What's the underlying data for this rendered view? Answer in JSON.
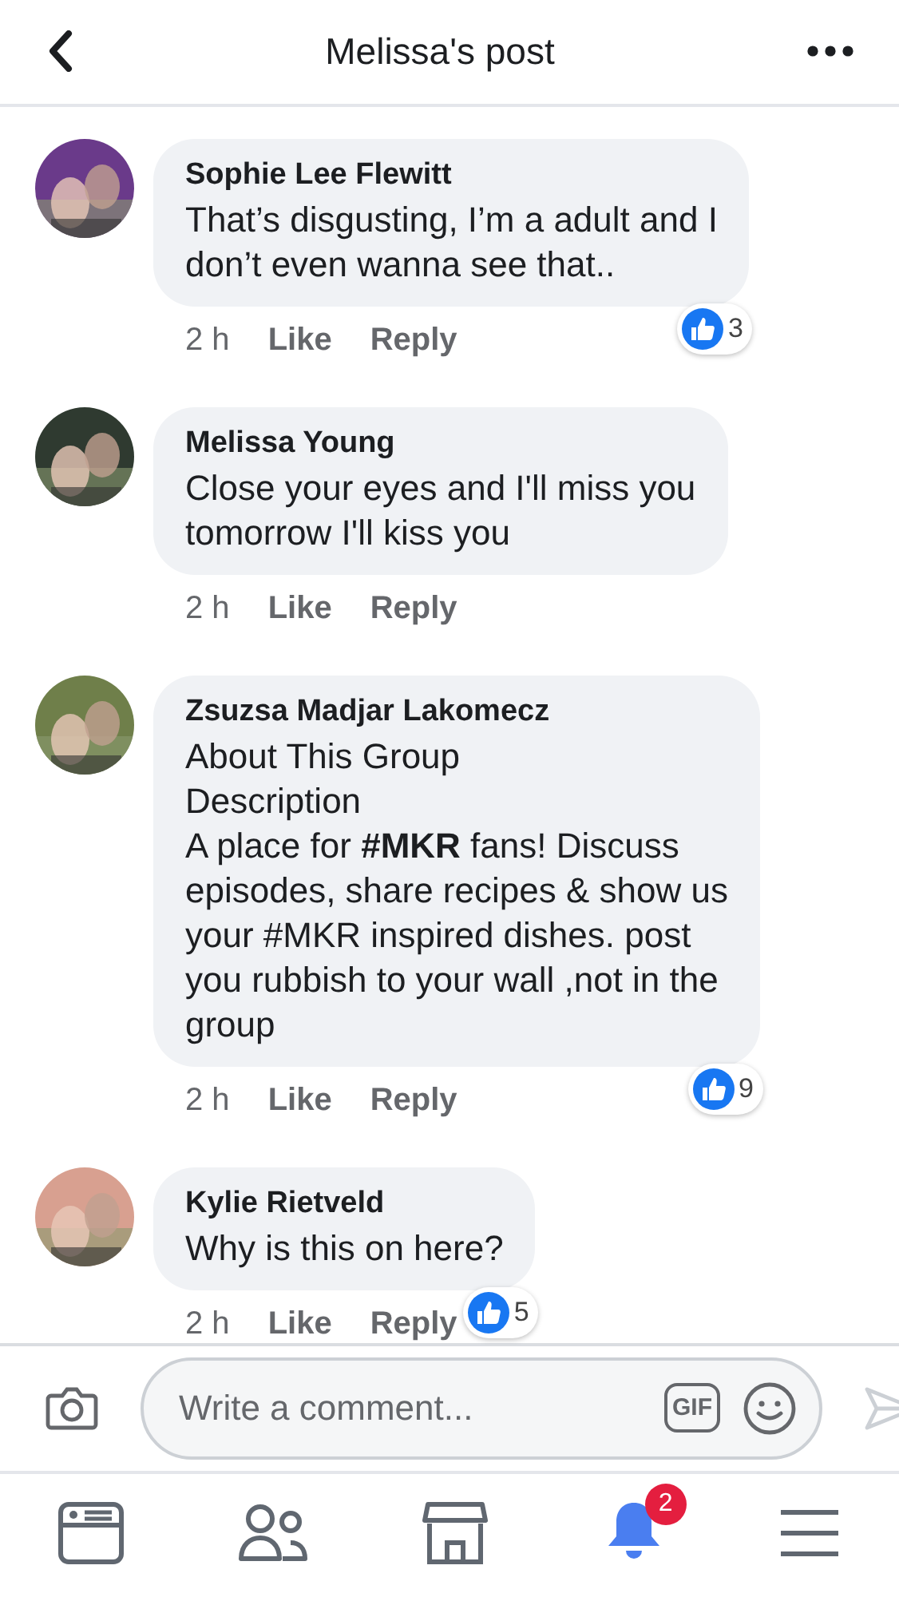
{
  "header": {
    "title": "Melissa's post"
  },
  "comments": [
    {
      "name": "Sophie Lee Flewitt",
      "text": "That’s disgusting, I’m a adult and I\ndon’t even wanna see that..",
      "time": "2 h",
      "like": "Like",
      "reply": "Reply",
      "likes": "3"
    },
    {
      "name": "Melissa Young",
      "text": "Close your eyes and I'll miss you\ntomorrow I'll kiss you",
      "time": "2 h",
      "like": "Like",
      "reply": "Reply"
    },
    {
      "name": "Zsuzsa Madjar Lakomecz",
      "text": "About This Group\nDescription\nA place for **#MKR** fans! Discuss\nepisodes, share recipes & show us\nyour #MKR inspired dishes.  post\nyou rubbish to your wall ,not in the\ngroup",
      "time": "2 h",
      "like": "Like",
      "reply": "Reply",
      "likes": "9"
    },
    {
      "name": "Kylie Rietveld",
      "text": "Why is this on here?",
      "time": "2 h",
      "like": "Like",
      "reply": "Reply",
      "likes": "5"
    }
  ],
  "composer": {
    "placeholder": "Write a comment...",
    "gif": "GIF"
  },
  "tabbar": {
    "badge": "2"
  }
}
